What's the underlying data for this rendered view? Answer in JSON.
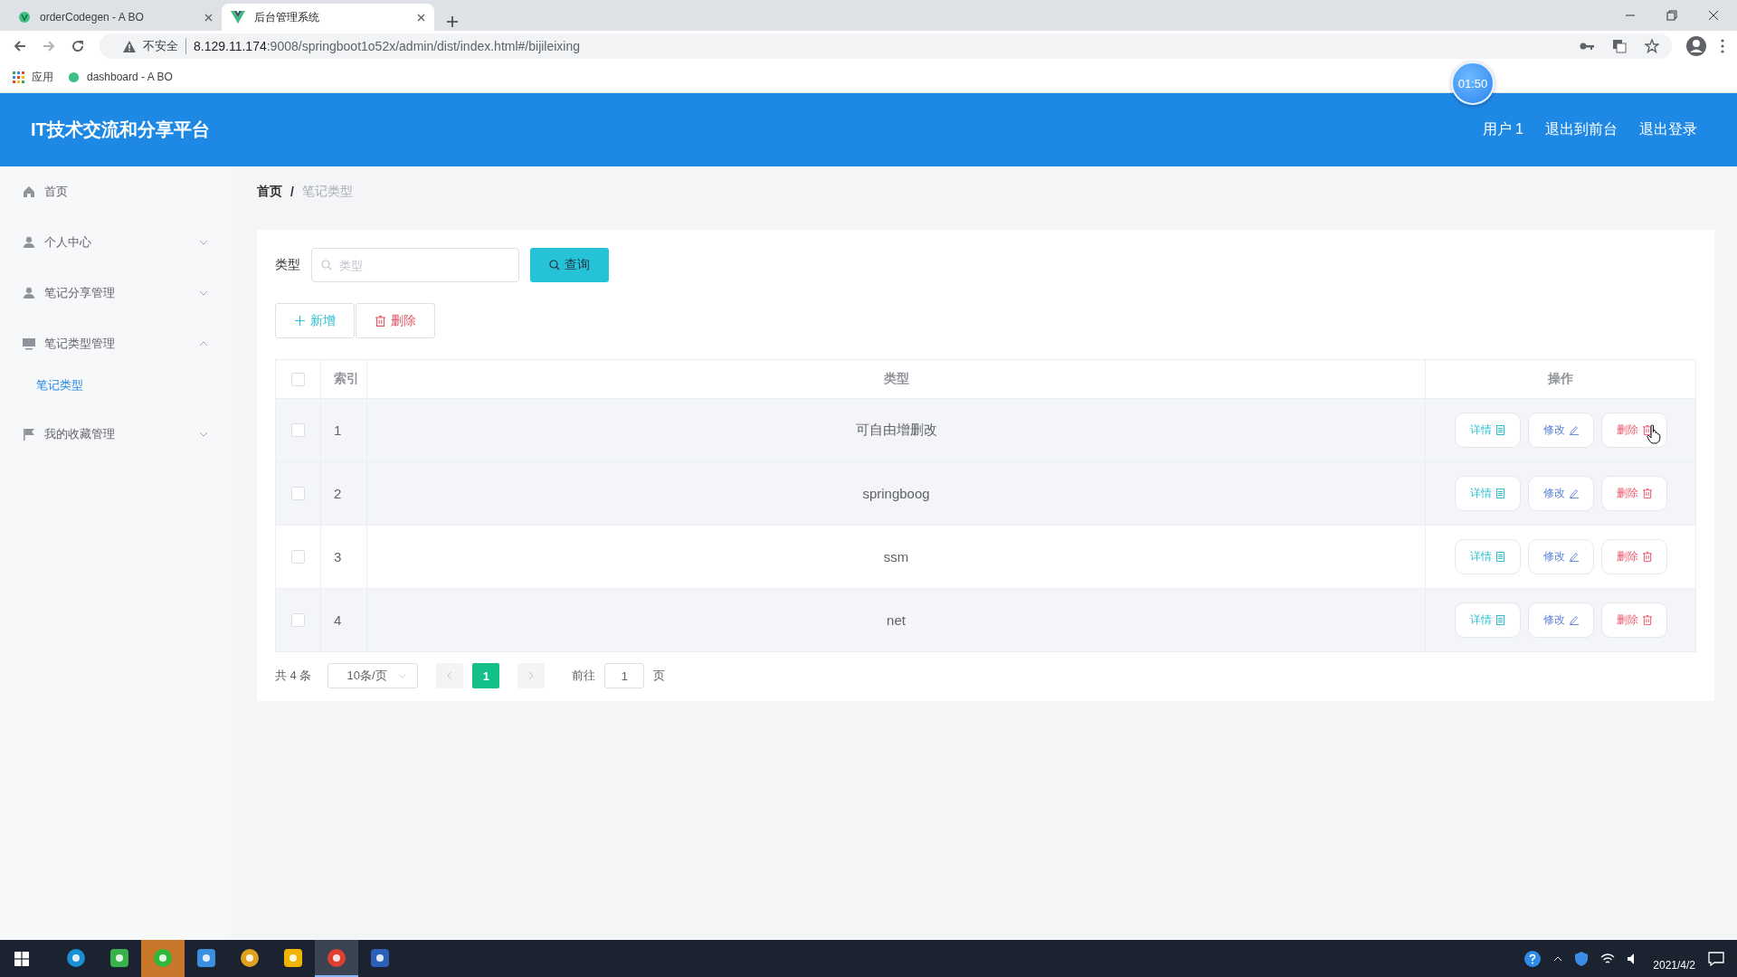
{
  "browser": {
    "tabs": [
      {
        "title": "orderCodegen - A BO",
        "selected": false
      },
      {
        "title": "后台管理系统",
        "selected": true
      }
    ],
    "security": "不安全",
    "url_host": "8.129.11.174",
    "url_rest": ":9008/springboot1o52x/admin/dist/index.html#/bijileixing",
    "bookmarks": [
      "应用",
      "dashboard - A BO"
    ],
    "timer": "01:50"
  },
  "header": {
    "title": "IT技术交流和分享平台",
    "links": [
      "用户 1",
      "退出到前台",
      "退出登录"
    ]
  },
  "sidebar": {
    "items": [
      {
        "label": "首页",
        "kind": "link"
      },
      {
        "label": "个人中心",
        "kind": "submenu",
        "expanded": false
      },
      {
        "label": "笔记分享管理",
        "kind": "submenu",
        "expanded": false
      },
      {
        "label": "笔记类型管理",
        "kind": "submenu",
        "expanded": true,
        "children": [
          {
            "label": "笔记类型",
            "selected": true
          }
        ]
      },
      {
        "label": "我的收藏管理",
        "kind": "submenu",
        "expanded": false
      }
    ]
  },
  "breadcrumb": {
    "items": [
      "首页",
      "笔记类型"
    ],
    "separator": "/"
  },
  "search": {
    "label": "类型",
    "placeholder": "类型",
    "button": "查询"
  },
  "toolbar": [
    {
      "label": "新增",
      "kind": "add"
    },
    {
      "label": "删除",
      "kind": "delete"
    }
  ],
  "table": {
    "columns": [
      "索引",
      "类型",
      "操作"
    ],
    "all_checked": false,
    "rows": [
      {
        "index": "1",
        "type": "可自由增删改",
        "checked": false,
        "hovered": true,
        "actions": [
          {
            "label": "详情",
            "kind": "detail"
          },
          {
            "label": "修改",
            "kind": "edit"
          },
          {
            "label": "删除",
            "kind": "delete"
          }
        ]
      },
      {
        "index": "2",
        "type": "springboog",
        "checked": false,
        "hovered": false,
        "actions": [
          {
            "label": "详情",
            "kind": "detail"
          },
          {
            "label": "修改",
            "kind": "edit"
          },
          {
            "label": "删除",
            "kind": "delete"
          }
        ]
      },
      {
        "index": "3",
        "type": "ssm",
        "checked": false,
        "hovered": false,
        "actions": [
          {
            "label": "详情",
            "kind": "detail"
          },
          {
            "label": "修改",
            "kind": "edit"
          },
          {
            "label": "删除",
            "kind": "delete"
          }
        ]
      },
      {
        "index": "4",
        "type": "net",
        "checked": false,
        "hovered": false,
        "actions": [
          {
            "label": "详情",
            "kind": "detail"
          },
          {
            "label": "修改",
            "kind": "edit"
          },
          {
            "label": "删除",
            "kind": "delete"
          }
        ]
      }
    ]
  },
  "pagination": {
    "total": "共 4 条",
    "page_size": "10条/页",
    "pages": [
      {
        "label": "1",
        "selected": true
      }
    ],
    "goto_label": "前往",
    "goto_value": "1",
    "page_suffix": "页"
  },
  "taskbar": {
    "apps": [
      {
        "flashing": false,
        "active": false
      },
      {
        "flashing": false,
        "active": false
      },
      {
        "flashing": true,
        "active": false
      },
      {
        "flashing": false,
        "active": false
      },
      {
        "flashing": false,
        "active": false
      },
      {
        "flashing": false,
        "active": false
      },
      {
        "flashing": false,
        "active": true
      },
      {
        "flashing": false,
        "active": false
      }
    ],
    "date": "2021/4/2"
  }
}
